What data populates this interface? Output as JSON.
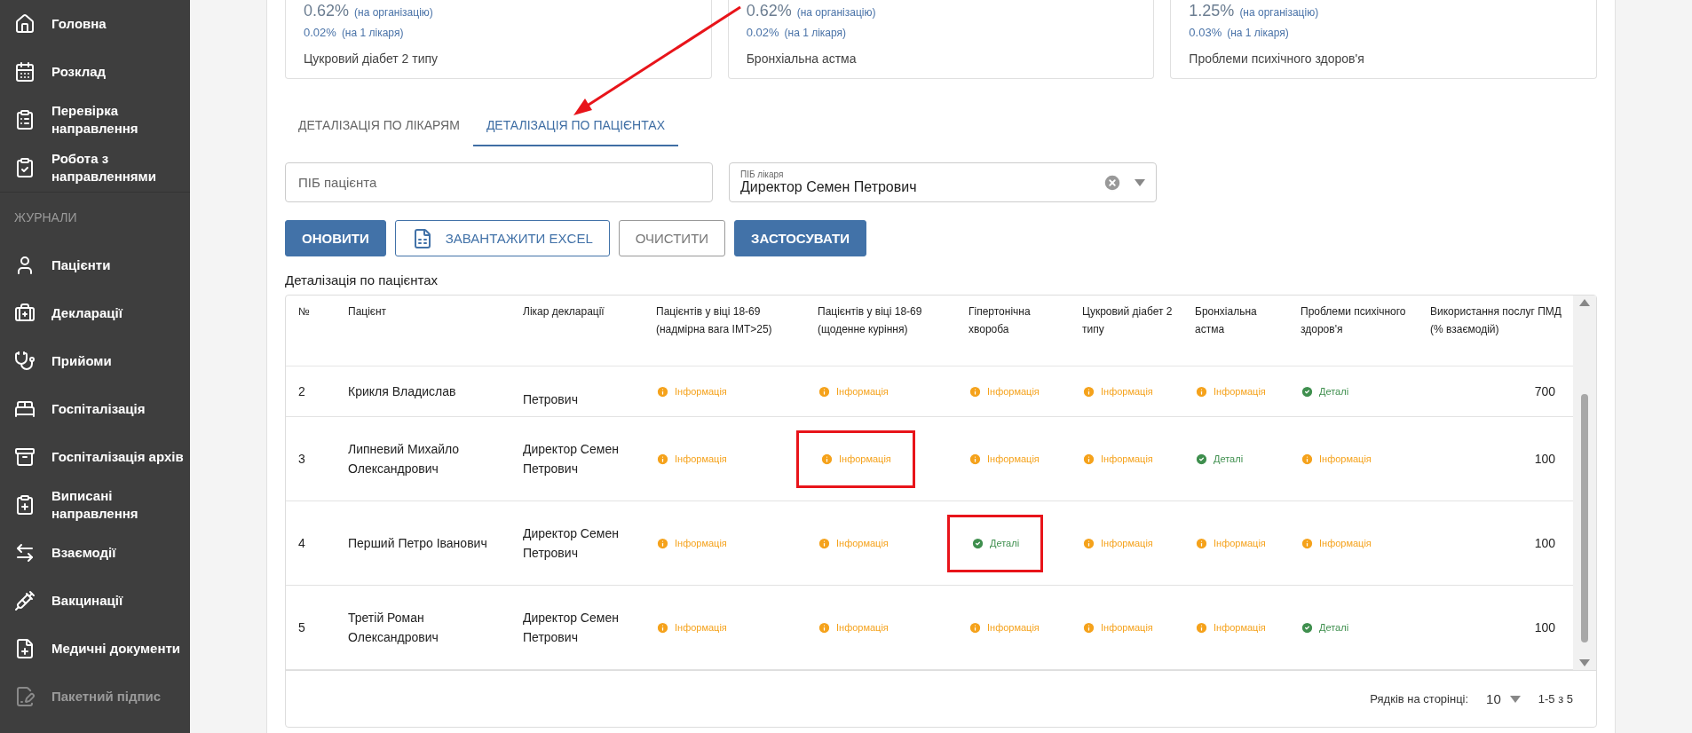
{
  "sidebar": {
    "items": [
      {
        "kind": "home",
        "label": "Головна",
        "disabled": false
      },
      {
        "kind": "calendar",
        "label": "Розклад",
        "disabled": false
      },
      {
        "kind": "checklist",
        "label": "Перевірка направлення",
        "disabled": false
      },
      {
        "kind": "clipboard-check",
        "label": "Робота з направленнями",
        "disabled": false
      },
      {
        "kind": "section",
        "label": "ЖУРНАЛИ"
      },
      {
        "kind": "person",
        "label": "Пацієнти",
        "disabled": false
      },
      {
        "kind": "medkit",
        "label": "Декларації",
        "disabled": false
      },
      {
        "kind": "stethoscope",
        "label": "Прийоми",
        "disabled": false
      },
      {
        "kind": "bed",
        "label": "Госпіталізація",
        "disabled": false
      },
      {
        "kind": "archive",
        "label": "Госпіталізація архів",
        "disabled": false
      },
      {
        "kind": "clipboard-pulse",
        "label": "Виписані направлення",
        "disabled": false
      },
      {
        "kind": "swap",
        "label": "Взаємодії",
        "disabled": false
      },
      {
        "kind": "syringe",
        "label": "Вакцинації",
        "disabled": false
      },
      {
        "kind": "file-plus",
        "label": "Медичні документи",
        "disabled": false
      },
      {
        "kind": "signature",
        "label": "Пакетний підпис",
        "disabled": true
      }
    ]
  },
  "stat_cards": [
    {
      "value": "0.62%",
      "value_note": "(на організацію)",
      "per_doctor": "0.02%",
      "per_doctor_note": "(на 1 лікаря)",
      "label": "Цукровий діабет 2 типу"
    },
    {
      "value": "0.62%",
      "value_note": "(на організацію)",
      "per_doctor": "0.02%",
      "per_doctor_note": "(на 1 лікаря)",
      "label": "Бронхіальна астма"
    },
    {
      "value": "1.25%",
      "value_note": "(на організацію)",
      "per_doctor": "0.03%",
      "per_doctor_note": "(на 1 лікаря)",
      "label": "Проблеми психічного здоров'я"
    }
  ],
  "tabs": [
    {
      "label": "ДЕТАЛІЗАЦІЯ ПО ЛІКАРЯМ",
      "selected": false
    },
    {
      "label": "ДЕТАЛІЗАЦІЯ ПО ПАЦІЄНТАХ",
      "selected": true
    }
  ],
  "filters": {
    "patient": {
      "placeholder": "ПІБ пацієнта"
    },
    "doctor": {
      "label": "ПІБ лікаря",
      "value": "Директор Семен Петрович"
    }
  },
  "buttons": [
    {
      "kind": "primary",
      "label": "ОНОВИТИ"
    },
    {
      "kind": "excel",
      "label": "ЗАВАНТАЖИТИ EXCEL"
    },
    {
      "kind": "outline",
      "label": "ОЧИСТИТИ"
    },
    {
      "kind": "primary",
      "label": "ЗАСТОСУВАТИ"
    }
  ],
  "table": {
    "title": "Деталізація по пацієнтах",
    "columns": [
      "№",
      "Пацієнт",
      "Лікар декларації",
      "Пацієнтів у віці 18-69 (надмірна вага ІМТ>25)",
      "Пацієнтів у віці 18-69 (щоденне куріння)",
      "Гіпертонічна хвороба",
      "Цукровий діабет 2 типу",
      "Бронхіальна астма",
      "Проблеми психічного здоров'я",
      "Використання послуг ПМД (% взаємодій)"
    ],
    "rows": [
      {
        "number": "2",
        "patient": "Крикля Владислав",
        "doctor": "Петрович",
        "cut": true,
        "statuses": [
          {
            "kind": "info",
            "label": "Інформація",
            "highlighted": false
          },
          {
            "kind": "info",
            "label": "Інформація",
            "highlighted": false
          },
          {
            "kind": "info",
            "label": "Інформація",
            "highlighted": false
          },
          {
            "kind": "info",
            "label": "Інформація",
            "highlighted": false
          },
          {
            "kind": "info",
            "label": "Інформація",
            "highlighted": false
          },
          {
            "kind": "details",
            "label": "Деталі",
            "highlighted": false
          }
        ],
        "usage": "700"
      },
      {
        "number": "3",
        "patient": "Липневий Михайло Олександрович",
        "doctor": "Директор Семен Петрович",
        "cut": false,
        "statuses": [
          {
            "kind": "info",
            "label": "Інформація",
            "highlighted": false
          },
          {
            "kind": "info",
            "label": "Інформація",
            "highlighted": true
          },
          {
            "kind": "info",
            "label": "Інформація",
            "highlighted": false
          },
          {
            "kind": "info",
            "label": "Інформація",
            "highlighted": false
          },
          {
            "kind": "details",
            "label": "Деталі",
            "highlighted": false
          },
          {
            "kind": "info",
            "label": "Інформація",
            "highlighted": false
          }
        ],
        "usage": "100"
      },
      {
        "number": "4",
        "patient": "Перший Петро Іванович",
        "doctor": "Директор Семен Петрович",
        "cut": false,
        "statuses": [
          {
            "kind": "info",
            "label": "Інформація",
            "highlighted": false
          },
          {
            "kind": "info",
            "label": "Інформація",
            "highlighted": false
          },
          {
            "kind": "details",
            "label": "Деталі",
            "highlighted": true
          },
          {
            "kind": "info",
            "label": "Інформація",
            "highlighted": false
          },
          {
            "kind": "info",
            "label": "Інформація",
            "highlighted": false
          },
          {
            "kind": "info",
            "label": "Інформація",
            "highlighted": false
          }
        ],
        "usage": "100"
      },
      {
        "number": "5",
        "patient": "Третій  Роман Олександрович",
        "doctor": "Директор Семен Петрович",
        "cut": false,
        "statuses": [
          {
            "kind": "info",
            "label": "Інформація",
            "highlighted": false
          },
          {
            "kind": "info",
            "label": "Інформація",
            "highlighted": false
          },
          {
            "kind": "info",
            "label": "Інформація",
            "highlighted": false
          },
          {
            "kind": "info",
            "label": "Інформація",
            "highlighted": false
          },
          {
            "kind": "info",
            "label": "Інформація",
            "highlighted": false
          },
          {
            "kind": "details",
            "label": "Деталі",
            "highlighted": false
          }
        ],
        "usage": "100"
      }
    ]
  },
  "pagination": {
    "rows_label": "Рядків на сторінці:",
    "rows_value": "10",
    "range": "1-5 з 5"
  }
}
